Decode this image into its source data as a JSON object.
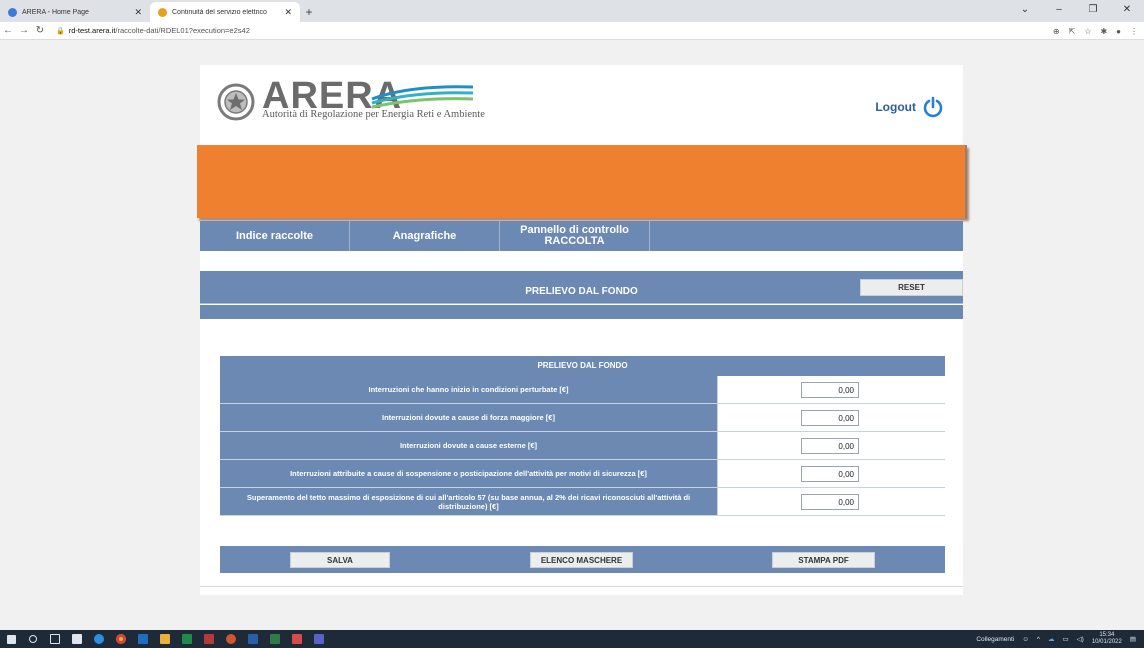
{
  "browser": {
    "tabs": [
      {
        "title": "ARERA - Home Page",
        "favicon_color": "#3d7bd8",
        "active": false
      },
      {
        "title": "Continuità del servizio elettrico",
        "favicon_color": "#e6a020",
        "active": true
      }
    ],
    "url_host": "rd-test.arera.it",
    "url_path": "/raccolte-dati/RDEL01?execution=e2s42"
  },
  "header": {
    "logo_text": "ARERA",
    "logo_subtitle": "Autorità di Regolazione per Energia Reti e Ambiente",
    "logout_label": "Logout"
  },
  "menu": {
    "items": [
      {
        "label": "Indice raccolte"
      },
      {
        "label": "Anagrafiche"
      },
      {
        "label": "Pannello di controllo RACCOLTA"
      }
    ]
  },
  "section": {
    "title": "PRELIEVO DAL FONDO",
    "reset_label": "RESET"
  },
  "form": {
    "title": "PRELIEVO DAL FONDO",
    "rows": [
      {
        "label": "Interruzioni che hanno inizio in condizioni perturbate [€]",
        "value": "0,00"
      },
      {
        "label": "Interruzioni dovute a cause di forza maggiore [€]",
        "value": "0,00"
      },
      {
        "label": "Interruzioni dovute a cause esterne [€]",
        "value": "0,00"
      },
      {
        "label": "Interruzioni attribuite a cause di sospensione o posticipazione dell'attività per motivi di sicurezza [€]",
        "value": "0,00"
      },
      {
        "label": "Superamento del tetto massimo di esposizione di cui all'articolo 57 (su base annua, al 2% dei ricavi riconosciuti all'attività di distribuzione) [€]",
        "value": "0,00"
      }
    ]
  },
  "actions": {
    "save": "SALVA",
    "list": "ELENCO MASCHERE",
    "pdf": "STAMPA PDF"
  },
  "colors": {
    "accent_orange": "#ef8030",
    "bar_blue": "#6c89b3"
  },
  "taskbar": {
    "links_label": "Collegamenti",
    "time": "15:34",
    "date": "10/01/2022"
  }
}
